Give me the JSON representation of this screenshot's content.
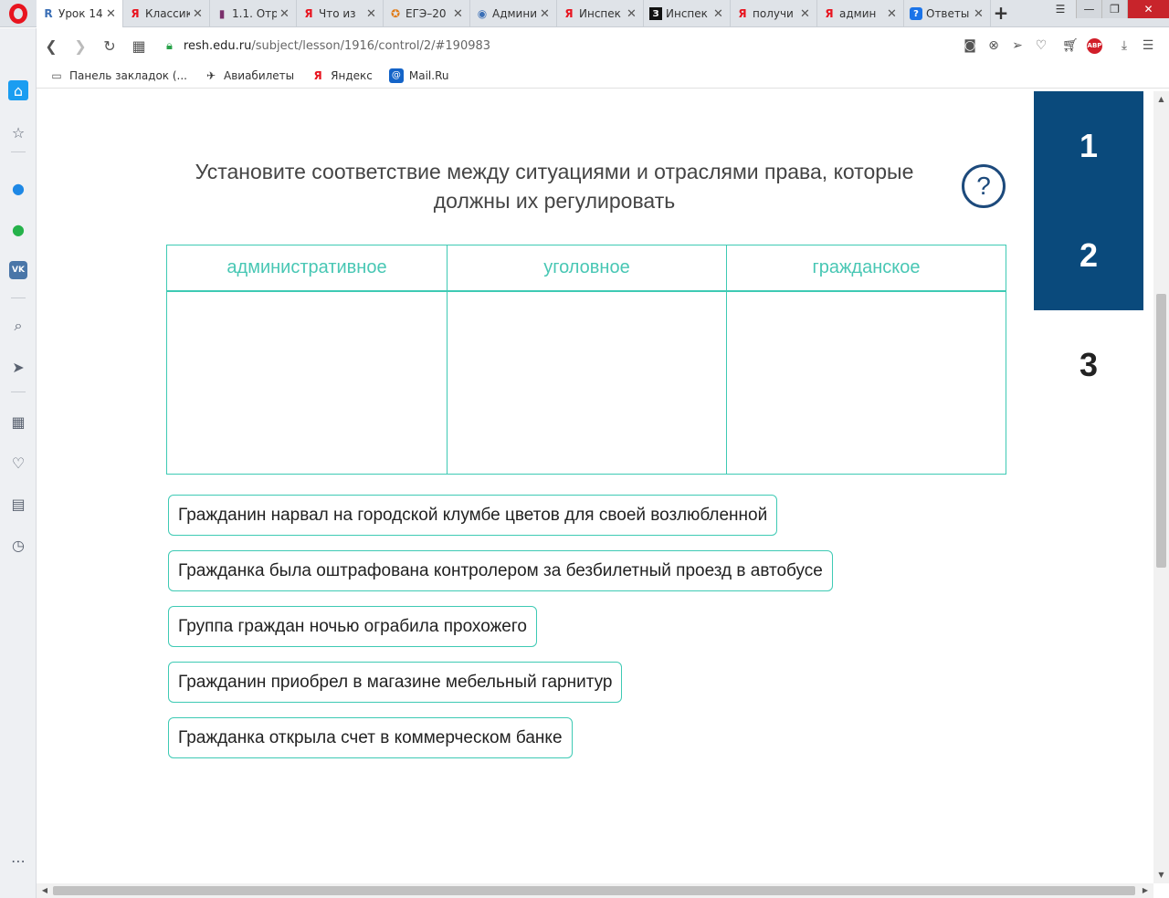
{
  "browser": {
    "tabs": [
      {
        "title": "Урок 14",
        "favicon": "R",
        "active": true
      },
      {
        "title": "Классик",
        "favicon": "Я",
        "active": false
      },
      {
        "title": "1.1. Отр",
        "favicon": "▮",
        "active": false
      },
      {
        "title": "Что из",
        "favicon": "Я",
        "active": false
      },
      {
        "title": "ЕГЭ–20",
        "favicon": "✪",
        "active": false
      },
      {
        "title": "Админи",
        "favicon": "◉",
        "active": false
      },
      {
        "title": "Инспек",
        "favicon": "Я",
        "active": false
      },
      {
        "title": "Инспек",
        "favicon": "З",
        "active": false
      },
      {
        "title": "получи",
        "favicon": "Я",
        "active": false
      },
      {
        "title": "админ",
        "favicon": "Я",
        "active": false
      },
      {
        "title": "Ответы",
        "favicon": "?",
        "active": false
      }
    ],
    "url": {
      "host": "resh.edu.ru",
      "path": "/subject/lesson/1916/control/2/#190983"
    },
    "bookmarks": [
      {
        "label": "Панель закладок (...",
        "icon": "folder-icon"
      },
      {
        "label": "Авиабилеты",
        "icon": "plane-icon"
      },
      {
        "label": "Яндекс",
        "icon": "yandex-icon"
      },
      {
        "label": "Mail.Ru",
        "icon": "mail-icon"
      }
    ],
    "adblock_label": "ABP"
  },
  "task": {
    "question": "Установите соответствие между ситуациями и отраслями права, которые должны их регулировать",
    "help_symbol": "?",
    "columns": [
      "административное",
      "уголовное",
      "гражданское"
    ],
    "cards": [
      "Гражданин нарвал на городской клумбе цветов для своей возлюбленной",
      "Гражданка была оштрафована контролером за безбилетный проезд в автобусе",
      "Группа граждан ночью ограбила прохожего",
      "Гражданин приобрел в магазине мебельный гарнитур",
      "Гражданка открыла счет в коммерческом банке"
    ]
  },
  "question_nav": [
    {
      "label": "1",
      "state": "done"
    },
    {
      "label": "2",
      "state": "done"
    },
    {
      "label": "3",
      "state": "current"
    }
  ],
  "colors": {
    "accent": "#3ecab4",
    "nav_done": "#0a4a7c",
    "help": "#1d4a7c"
  }
}
